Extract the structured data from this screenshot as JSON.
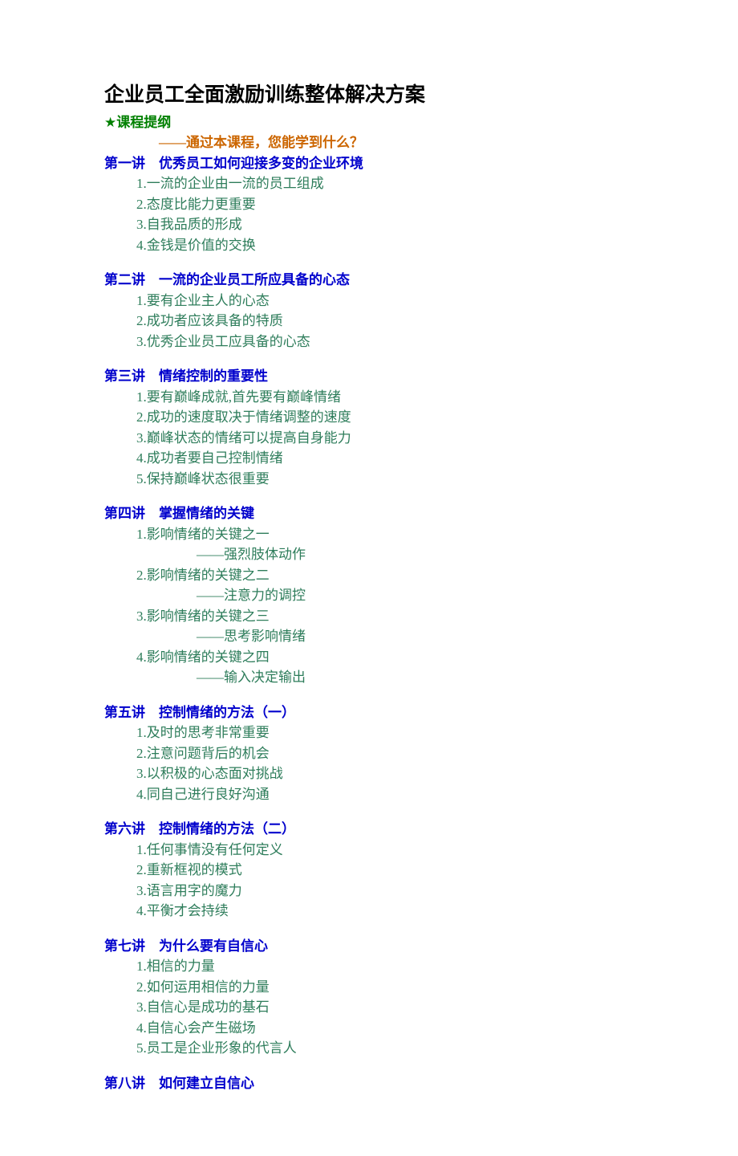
{
  "title": "企业员工全面激励训练整体解决方案",
  "section_header": "课程提纲",
  "star": "★",
  "subtitle": "——通过本课程，您能学到什么？",
  "lectures": [
    {
      "title": "第一讲　优秀员工如何迎接多变的企业环境",
      "items": [
        {
          "text": "1.一流的企业由一流的员工组成"
        },
        {
          "text": "2.态度比能力更重要"
        },
        {
          "text": "3.自我品质的形成"
        },
        {
          "text": "4.金钱是价值的交换"
        }
      ]
    },
    {
      "title": "第二讲　一流的企业员工所应具备的心态",
      "items": [
        {
          "text": "1.要有企业主人的心态"
        },
        {
          "text": "2.成功者应该具备的特质"
        },
        {
          "text": "3.优秀企业员工应具备的心态"
        }
      ]
    },
    {
      "title": "第三讲　情绪控制的重要性",
      "items": [
        {
          "text": "1.要有巅峰成就,首先要有巅峰情绪"
        },
        {
          "text": "2.成功的速度取决于情绪调整的速度"
        },
        {
          "text": "3.巅峰状态的情绪可以提高自身能力"
        },
        {
          "text": "4.成功者要自己控制情绪"
        },
        {
          "text": "5.保持巅峰状态很重要"
        }
      ]
    },
    {
      "title": "第四讲　掌握情绪的关键",
      "items": [
        {
          "text": "1.影响情绪的关键之一",
          "sub": "——强烈肢体动作"
        },
        {
          "text": "2.影响情绪的关键之二",
          "sub": "——注意力的调控"
        },
        {
          "text": "3.影响情绪的关键之三",
          "sub": "——思考影响情绪"
        },
        {
          "text": "4.影响情绪的关键之四",
          "sub": "——输入决定输出"
        }
      ]
    },
    {
      "title": "第五讲　控制情绪的方法（一）",
      "items": [
        {
          "text": "1.及时的思考非常重要"
        },
        {
          "text": "2.注意问题背后的机会"
        },
        {
          "text": "3.以积极的心态面对挑战"
        },
        {
          "text": "4.同自己进行良好沟通"
        }
      ]
    },
    {
      "title": "第六讲　控制情绪的方法（二）",
      "items": [
        {
          "text": "1.任何事情没有任何定义"
        },
        {
          "text": "2.重新框视的模式"
        },
        {
          "text": "3.语言用字的魔力"
        },
        {
          "text": "4.平衡才会持续"
        }
      ]
    },
    {
      "title": "第七讲　为什么要有自信心",
      "items": [
        {
          "text": "1.相信的力量"
        },
        {
          "text": "2.如何运用相信的力量"
        },
        {
          "text": "3.自信心是成功的基石"
        },
        {
          "text": "4.自信心会产生磁场"
        },
        {
          "text": "5.员工是企业形象的代言人"
        }
      ]
    },
    {
      "title": "第八讲　如何建立自信心",
      "items": []
    }
  ]
}
